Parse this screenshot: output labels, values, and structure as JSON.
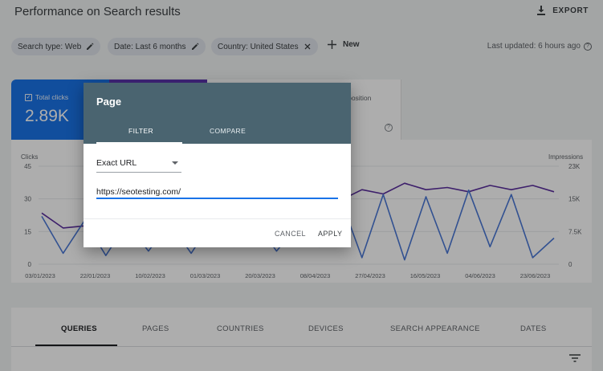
{
  "header": {
    "title": "Performance on Search results",
    "export_label": "EXPORT"
  },
  "filters": {
    "chips": [
      {
        "label": "Search type: Web",
        "icon": "pencil-icon"
      },
      {
        "label": "Date: Last 6 months",
        "icon": "pencil-icon"
      },
      {
        "label": "Country: United States",
        "icon": "close-icon"
      }
    ],
    "new_label": "New",
    "last_updated": "Last updated: 6 hours ago"
  },
  "metrics": {
    "clicks_label": "Total clicks",
    "clicks_value": "2.89K",
    "position_label": "e position"
  },
  "chart": {
    "left_axis_title": "Clicks",
    "right_axis_title": "Impressions",
    "left_ticks": [
      "45",
      "30",
      "15",
      "0"
    ],
    "right_ticks": [
      "23K",
      "15K",
      "7.5K",
      "0"
    ],
    "x_ticks": [
      "03/01/2023",
      "22/01/2023",
      "10/02/2023",
      "01/03/2023",
      "20/03/2023",
      "08/04/2023",
      "27/04/2023",
      "16/05/2023",
      "04/06/2023",
      "23/06/2023"
    ],
    "colors": {
      "clicks": "#4a78d6",
      "impressions": "#5b2f9e"
    }
  },
  "chart_data": {
    "type": "line",
    "x": [
      "03/01/2023",
      "22/01/2023",
      "10/02/2023",
      "01/03/2023",
      "20/03/2023",
      "08/04/2023",
      "27/04/2023",
      "16/05/2023",
      "04/06/2023",
      "23/06/2023"
    ],
    "series": [
      {
        "name": "Clicks",
        "axis": "left",
        "values": [
          22,
          5,
          20,
          4,
          19,
          6,
          19,
          5,
          20,
          8,
          20,
          6,
          18,
          8,
          30,
          3,
          32,
          2,
          31,
          5,
          34,
          8,
          32,
          3,
          12
        ]
      },
      {
        "name": "Impressions",
        "axis": "right",
        "values": [
          12000,
          8500,
          9000,
          10500,
          11000,
          12500,
          13000,
          14000,
          13500,
          15000,
          14500,
          15500,
          14000,
          16000,
          15000,
          17500,
          16500,
          19000,
          17500,
          18000,
          17000,
          18500,
          17500,
          18500,
          17000
        ]
      }
    ],
    "ylim_left": [
      0,
      45
    ],
    "ylim_right": [
      0,
      23000
    ],
    "grid": true
  },
  "tabs": [
    "QUERIES",
    "PAGES",
    "COUNTRIES",
    "DEVICES",
    "SEARCH APPEARANCE",
    "DATES"
  ],
  "dialog": {
    "title": "Page",
    "tabs": [
      "FILTER",
      "COMPARE"
    ],
    "match_type": "Exact URL",
    "url_value": "https://seotesting.com/",
    "cancel_label": "CANCEL",
    "apply_label": "APPLY"
  }
}
